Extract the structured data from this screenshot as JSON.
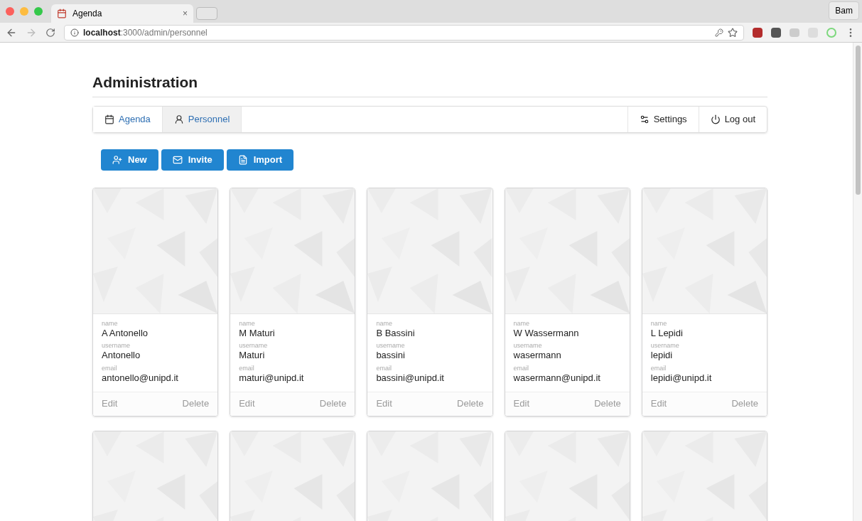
{
  "browser": {
    "tab_title": "Agenda",
    "tab_close": "×",
    "profile": "Bam",
    "address": "**localhost**:3000/admin/personnel"
  },
  "page_title": "Administration",
  "nav": {
    "left": [
      {
        "label": "Agenda",
        "selected": false
      },
      {
        "label": "Personnel",
        "selected": true
      }
    ],
    "right": [
      {
        "label": "Settings"
      },
      {
        "label": "Log out"
      }
    ]
  },
  "actions": [
    {
      "label": "New"
    },
    {
      "label": "Invite"
    },
    {
      "label": "Import"
    }
  ],
  "cards": [
    {
      "name_label": "name",
      "name": "A Antonello",
      "username_label": "username",
      "username": "Antonello",
      "email_label": "email",
      "email": "antonello@unipd.it",
      "edit": "Edit",
      "delete": "Delete"
    },
    {
      "name_label": "name",
      "name": "M Maturi",
      "username_label": "username",
      "username": "Maturi",
      "email_label": "email",
      "email": "maturi@unipd.it",
      "edit": "Edit",
      "delete": "Delete"
    },
    {
      "name_label": "name",
      "name": "B Bassini",
      "username_label": "username",
      "username": "bassini",
      "email_label": "email",
      "email": "bassini@unipd.it",
      "edit": "Edit",
      "delete": "Delete"
    },
    {
      "name_label": "name",
      "name": "W Wassermann",
      "username_label": "username",
      "username": "wasermann",
      "email_label": "email",
      "email": "wasermann@unipd.it",
      "edit": "Edit",
      "delete": "Delete"
    },
    {
      "name_label": "name",
      "name": "L Lepidi",
      "username_label": "username",
      "username": "lepidi",
      "email_label": "email",
      "email": "lepidi@unipd.it",
      "edit": "Edit",
      "delete": "Delete"
    }
  ]
}
